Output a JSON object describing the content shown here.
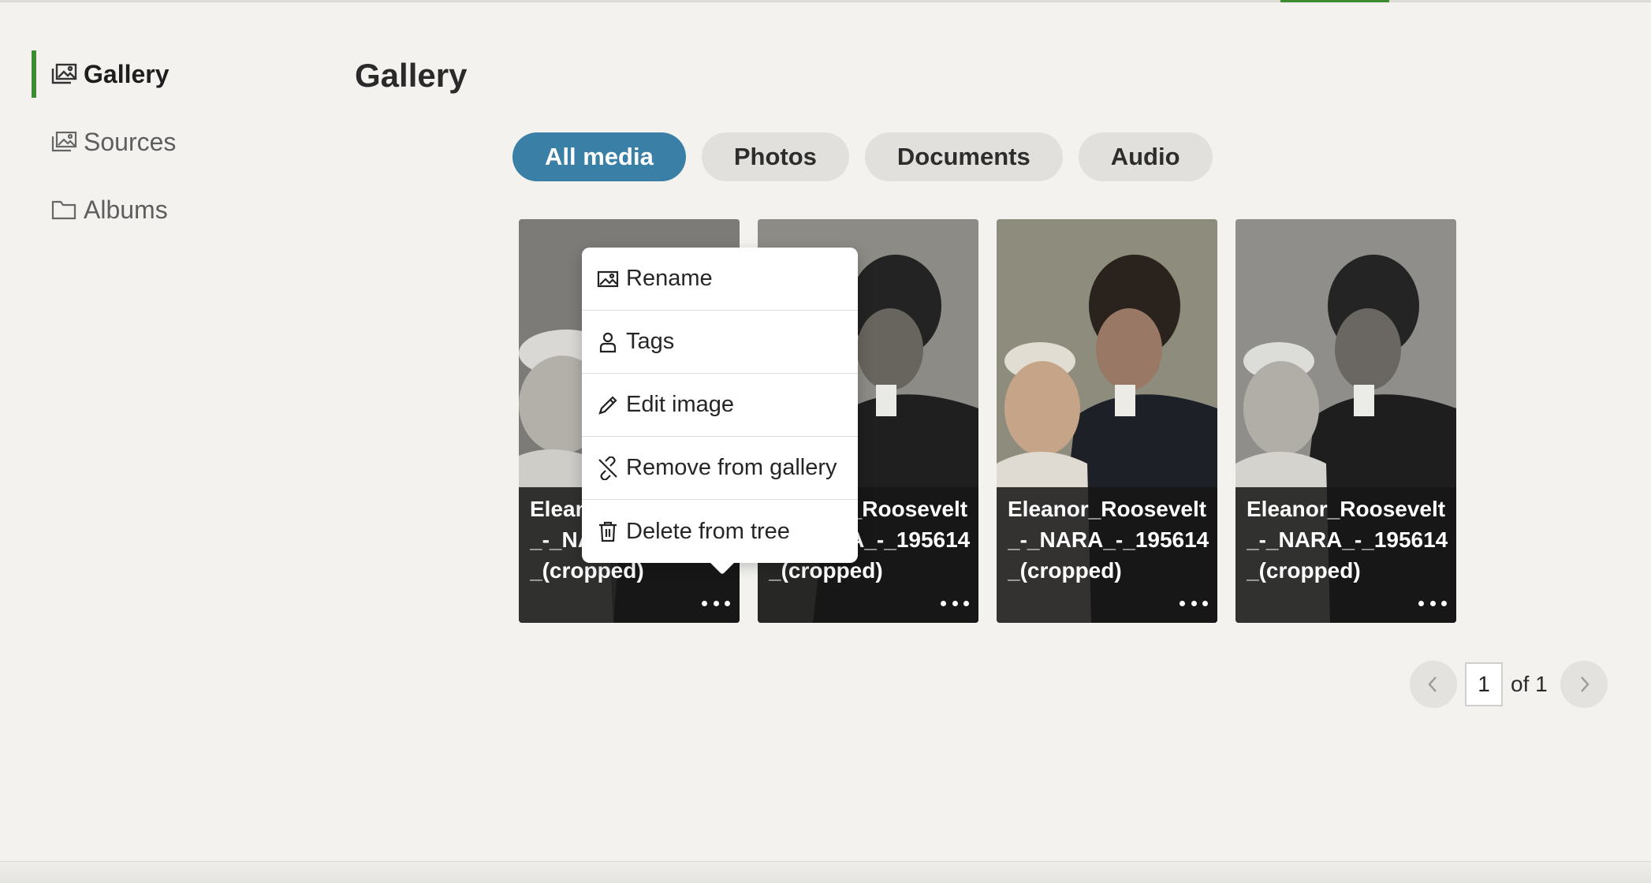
{
  "sidebar": {
    "items": [
      {
        "label": "Gallery",
        "icon": "gallery-icon",
        "active": true
      },
      {
        "label": "Sources",
        "icon": "sources-icon",
        "active": false
      },
      {
        "label": "Albums",
        "icon": "folder-icon",
        "active": false
      }
    ]
  },
  "page": {
    "title": "Gallery"
  },
  "filters": [
    "All media",
    "Photos",
    "Documents",
    "Audio"
  ],
  "cards": [
    {
      "caption": "Eleanor_Roosevelt_-_NARA_-_195614_(cropped)"
    },
    {
      "caption": "Eleanor_Roosevelt_-_NARA_-_195614_(cropped)"
    },
    {
      "caption": "Eleanor_Roosevelt_-_NARA_-_195614_(cropped)"
    },
    {
      "caption": "Eleanor_Roosevelt_-_NARA_-_195614_(cropped)"
    }
  ],
  "context_menu": {
    "items": [
      {
        "label": "Rename",
        "icon": "image-icon"
      },
      {
        "label": "Tags",
        "icon": "person-icon"
      },
      {
        "label": "Edit image",
        "icon": "pencil-icon"
      },
      {
        "label": "Remove from gallery",
        "icon": "unlink-icon"
      },
      {
        "label": "Delete from tree",
        "icon": "trash-icon"
      }
    ]
  },
  "pagination": {
    "current": "1",
    "of_label": "of 1"
  },
  "colors": {
    "accent_green": "#3d8b32",
    "active_pill": "#3a7fa6",
    "background": "#f3f2ef"
  }
}
